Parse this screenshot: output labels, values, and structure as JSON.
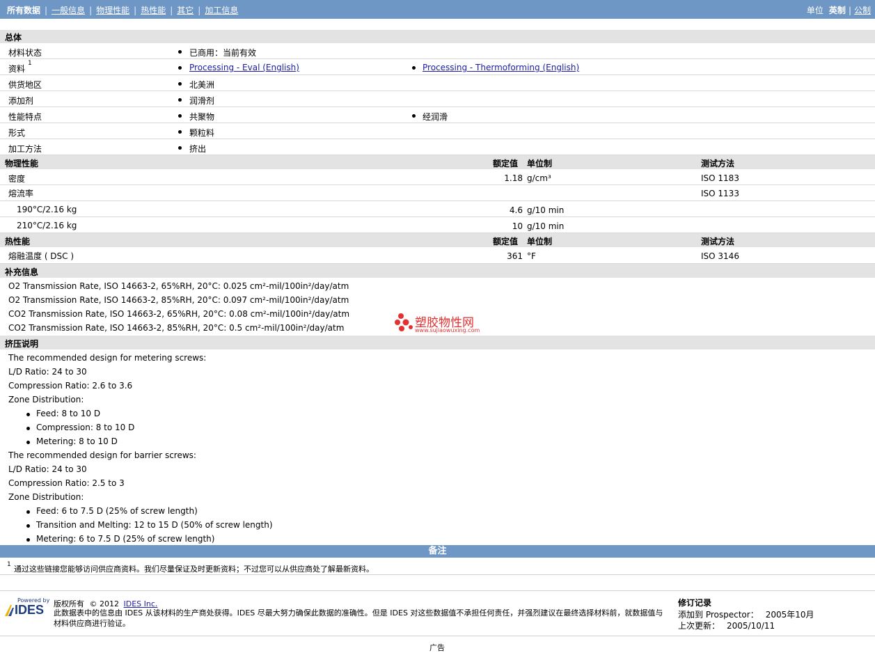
{
  "header": {
    "tabs": [
      "所有数据",
      "一般信息",
      "物理性能",
      "热性能",
      "其它",
      "加工信息"
    ],
    "units_label": "单位",
    "units": [
      "英制",
      "公制"
    ]
  },
  "general": {
    "title": "总体",
    "rows": [
      {
        "label": "材料状态",
        "v1": "已商用：当前有效",
        "v2": ""
      },
      {
        "label": "资料",
        "sup": "1",
        "v1": "Processing - Eval (English)",
        "v2": "Processing - Thermoforming (English)"
      },
      {
        "label": "供货地区",
        "v1": "北美洲",
        "v2": ""
      },
      {
        "label": "添加剂",
        "v1": "润滑剂",
        "v2": ""
      },
      {
        "label": "性能特点",
        "v1": "共聚物",
        "v2": "经润滑"
      },
      {
        "label": "形式",
        "v1": "颗粒料",
        "v2": ""
      },
      {
        "label": "加工方法",
        "v1": "挤出",
        "v2": ""
      }
    ]
  },
  "physical": {
    "title": "物理性能",
    "col_value": "额定值",
    "col_unit": "单位制",
    "col_method": "测试方法",
    "rows": [
      {
        "label": "密度",
        "value": "1.18",
        "unit": "g/cm³",
        "method": "ISO 1183"
      },
      {
        "label": "熔流率",
        "value": "",
        "unit": "",
        "method": "ISO 1133"
      },
      {
        "label": "190°C/2.16 kg",
        "value": "4.6",
        "unit": "g/10 min",
        "method": ""
      },
      {
        "label": "210°C/2.16 kg",
        "value": "10",
        "unit": "g/10 min",
        "method": ""
      }
    ]
  },
  "thermal": {
    "title": "热性能",
    "col_value": "额定值",
    "col_unit": "单位制",
    "col_method": "测试方法",
    "rows": [
      {
        "label": "熔融温度 ( DSC )",
        "value": "361",
        "unit": "°F",
        "method": "ISO 3146"
      }
    ]
  },
  "supplement": {
    "title": "补充信息",
    "lines": [
      "O2 Transmission Rate, ISO 14663-2, 65%RH, 20°C: 0.025 cm²-mil/100in²/day/atm",
      "O2 Transmission Rate, ISO 14663-2, 85%RH, 20°C: 0.097 cm²-mil/100in²/day/atm",
      "CO2 Transmission Rate, ISO 14663-2, 65%RH, 20°C: 0.08 cm²-mil/100in²/day/atm",
      "CO2 Transmission Rate, ISO 14663-2, 85%RH, 20°C: 0.5 cm²-mil/100in²/day/atm"
    ],
    "watermark_cn": "塑胶物性网",
    "watermark_url": "www.sujiaowuxing.com"
  },
  "extrusion": {
    "title": "挤压说明",
    "lines": [
      "The recommended design for metering screws:",
      "L/D Ratio: 24 to 30",
      "Compression Ratio: 2.6 to 3.6",
      "Zone Distribution:",
      "Feed: 8 to 10 D",
      "Compression: 8 to 10 D",
      "Metering: 8 to 10 D",
      "The recommended design for barrier screws:",
      "L/D Ratio: 24 to 30",
      "Compression Ratio: 2.5 to 3",
      "Zone Distribution:",
      "Feed: 6 to 7.5 D (25% of screw length)",
      "Transition and Melting: 12 to 15 D (50% of screw length)",
      "Metering: 6 to 7.5 D (25% of screw length)"
    ]
  },
  "notes": {
    "title": "备注",
    "footnote_num": "1",
    "footnote": "通过这些链接您能够访问供应商资料。我们尽量保证及时更新资料；不过您可以从供应商处了解最新资料。"
  },
  "footer": {
    "powered_by": "Powered by",
    "logo": "IDES",
    "copyright_label": "版权所有",
    "copyright_year": "© 2012",
    "copyright_link": "IDES Inc.",
    "disclaimer": "此数据表中的信息由 IDES 从该材料的生产商处获得。IDES 尽最大努力确保此数据的准确性。但是 IDES 对这些数据值不承担任何责任，并强烈建议在最终选择材料前，就数据值与材料供应商进行验证。",
    "revision_title": "修订记录",
    "added_label": "添加到 Prospector：",
    "added_value": "2005年10月",
    "updated_label": "上次更新：",
    "updated_value": "2005/10/11",
    "bottom_text": "广告"
  }
}
